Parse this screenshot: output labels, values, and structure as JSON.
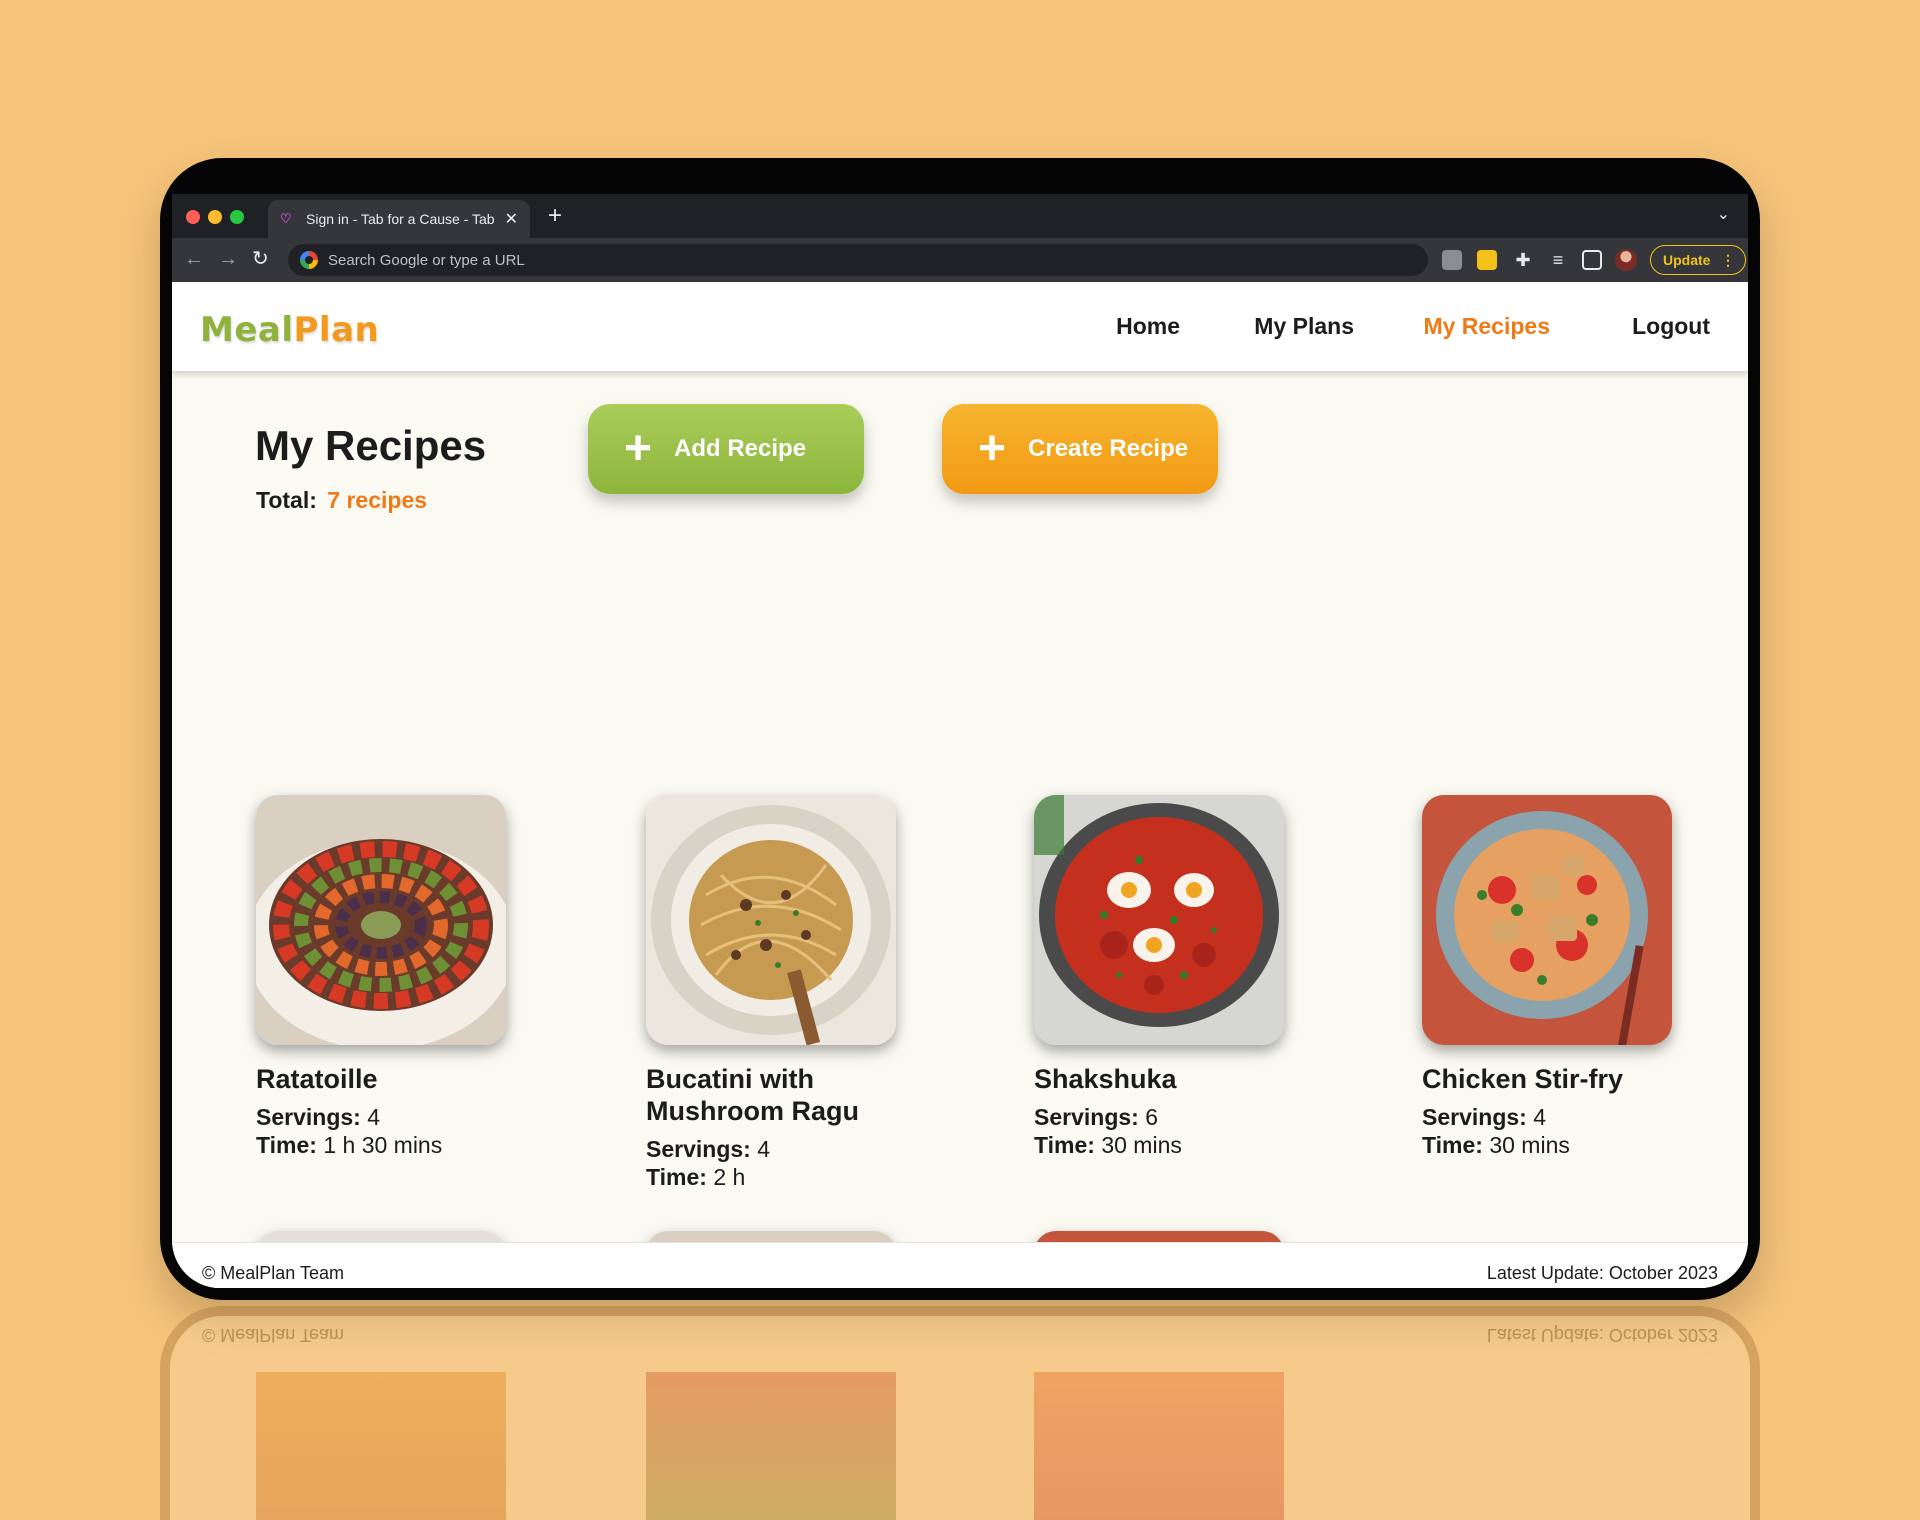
{
  "browser": {
    "tab_title": "Sign in - Tab for a Cause - Tab",
    "tab_close": "✕",
    "new_tab": "+",
    "omnibox_placeholder": "Search Google or type a URL",
    "update_label": "Update",
    "update_menu": "⋮"
  },
  "header": {
    "logo_part1": "Meal",
    "logo_part2": "Plan",
    "nav": {
      "home": "Home",
      "plans": "My Plans",
      "recipes": "My Recipes",
      "logout": "Logout"
    },
    "active_nav": "My Recipes"
  },
  "page": {
    "title": "My Recipes",
    "total_label": "Total:",
    "total_value": "7 recipes",
    "add_button": "Add Recipe",
    "create_button": "Create Recipe",
    "plus": "+"
  },
  "labels": {
    "servings": "Servings:",
    "time": "Time:"
  },
  "recipes": [
    {
      "name": "Ratatoille",
      "servings": "4",
      "time": "1 h 30 mins",
      "image": "ratatouille"
    },
    {
      "name": "Bucatini with Mushroom Ragu",
      "servings": "4",
      "time": "2 h",
      "image": "pasta"
    },
    {
      "name": "Shakshuka",
      "servings": "6",
      "time": "30 mins",
      "image": "shakshuka"
    },
    {
      "name": "Chicken Stir-fry",
      "servings": "4",
      "time": "30 mins",
      "image": "stir-fry"
    },
    {
      "name": "",
      "servings": "",
      "time": "",
      "image": "curry-soup"
    },
    {
      "name": "",
      "servings": "",
      "time": "",
      "image": "ratatouille"
    },
    {
      "name": "",
      "servings": "",
      "time": "",
      "image": "stir-fry"
    }
  ],
  "footer": {
    "left": "© MealPlan Team",
    "right": "Latest Update: October 2023"
  },
  "colors": {
    "background": "#f5c37a",
    "accent_orange": "#ef7a17",
    "accent_green": "#8db53c",
    "logo_green": "#8fb23c",
    "logo_orange": "#f39a1e",
    "page_bg": "#fafaf2"
  }
}
